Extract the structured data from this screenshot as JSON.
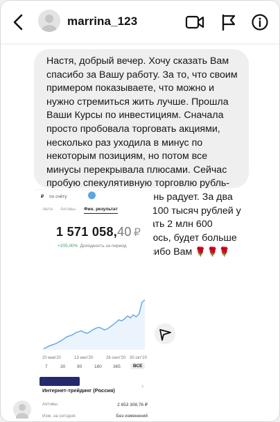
{
  "header": {
    "username": "marrina_123"
  },
  "message": {
    "text": "Настя, добрый вечер. Хочу сказать Вам спасибо за Вашу работу. За то, что своим примером показываете, что можно и нужно стремиться жить лучше. Прошла Ваши Курсы по инвестициям. Сначала просто пробовала торговать акциями, несколько раз уходила в минус по некоторым позициям, но потом все минусы перекрывала плюсами. Сейчас пробую спекулятивную торговлю рубль-доллар и результат очень радует. За два месяца с суммы 1 млн 100 тысяч рублей у меня получилось сделать 2 млн 600 тысяч. Дальше, я надеюсь, будет больше и лучше). Ещё раз спасибо Вам",
    "emoji": "🌹🌹🌹"
  },
  "screenshot": {
    "top_label": "по счёту",
    "tabs": [
      "люта",
      "Активы",
      "Фин. результат"
    ],
    "balance_int": "1 571 058,",
    "balance_frac": "40",
    "currency": "₽",
    "yield_pct": "+205,00%",
    "yield_label": "Доходность за период",
    "x_ticks": [
      "20 мая'20",
      "13 июл'20",
      "26 сент'20",
      "30 окт'20"
    ],
    "periods": [
      "7",
      "30",
      "90",
      "180",
      "365",
      "ВСЕ"
    ],
    "account_name": "Интернет-трейдинг (Россия)",
    "rows": [
      {
        "label": "Активы",
        "value": "2 653 308,76 ₽"
      },
      {
        "label": "Изм. за сегодня",
        "value": "Без изменений"
      }
    ]
  },
  "chart_data": {
    "type": "line",
    "x": [
      "20 мая'20",
      "13 июл'20",
      "26 сент'20",
      "30 окт'20"
    ],
    "series": [
      {
        "values": [
          0.02,
          0.05,
          0.08,
          0.1,
          0.12,
          0.15,
          0.18,
          0.22,
          0.26,
          0.28,
          0.3,
          0.34,
          0.36,
          0.38,
          0.35,
          0.33,
          0.36,
          0.4,
          0.43,
          0.45,
          0.43,
          0.4,
          0.42,
          0.46,
          0.5,
          0.55,
          0.6,
          0.58,
          0.62,
          0.68,
          0.64,
          0.7,
          0.66,
          0.72,
          0.95,
          1.0
        ]
      }
    ],
    "color": "#5aa6e6"
  }
}
